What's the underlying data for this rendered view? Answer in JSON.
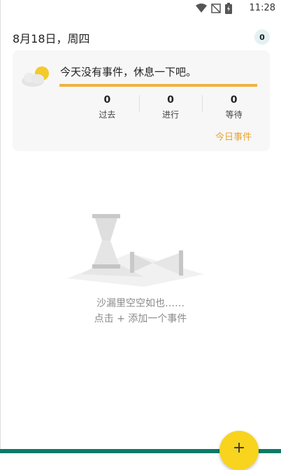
{
  "status_bar": {
    "time": "11:28",
    "icons": [
      "wifi-icon",
      "no-signal-icon",
      "battery-icon"
    ]
  },
  "header": {
    "date": "8月18日，周四",
    "event_count": "0"
  },
  "summary_card": {
    "message": "今天没有事件，休息一下吧。",
    "weather_icon": "sun-cloud-icon",
    "progress_color": "#f0b13f",
    "stats": [
      {
        "value": "0",
        "label": "过去"
      },
      {
        "value": "0",
        "label": "进行"
      },
      {
        "value": "0",
        "label": "等待"
      }
    ],
    "link": "今日事件"
  },
  "empty_state": {
    "illustration": "hourglass-icon",
    "line1": "沙漏里空空如也……",
    "line2": "点击 + 添加一个事件"
  },
  "fab": {
    "label": "+",
    "color": "#f8d41e"
  },
  "colors": {
    "accent": "#e8a534",
    "bottom_bar": "#0d7a68"
  }
}
